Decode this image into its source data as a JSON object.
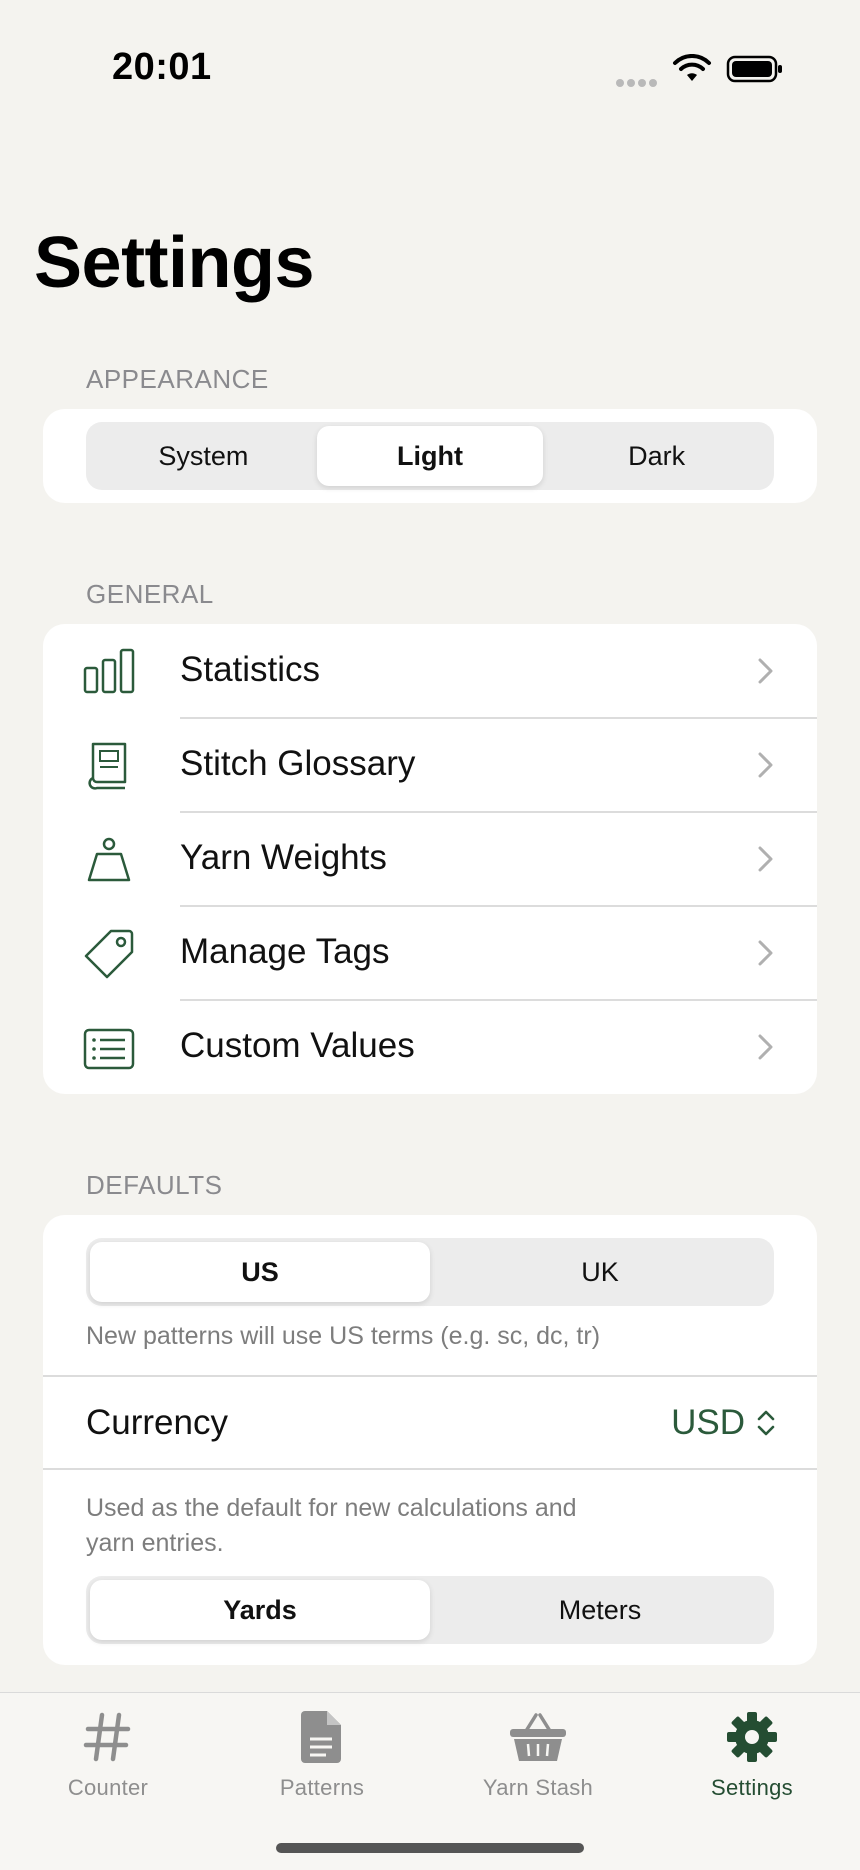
{
  "status_bar": {
    "time": "20:01"
  },
  "page": {
    "title": "Settings"
  },
  "appearance": {
    "header": "APPEARANCE",
    "options": [
      "System",
      "Light",
      "Dark"
    ],
    "selected": "Light"
  },
  "general": {
    "header": "GENERAL",
    "items": [
      {
        "label": "Statistics",
        "icon": "bar-chart-icon"
      },
      {
        "label": "Stitch Glossary",
        "icon": "book-icon"
      },
      {
        "label": "Yarn Weights",
        "icon": "weight-icon"
      },
      {
        "label": "Manage Tags",
        "icon": "tag-icon"
      },
      {
        "label": "Custom Values",
        "icon": "list-icon"
      }
    ]
  },
  "defaults": {
    "header": "DEFAULTS",
    "terms": {
      "options": [
        "US",
        "UK"
      ],
      "selected": "US"
    },
    "terms_hint": "New patterns will use US terms (e.g. sc, dc, tr)",
    "currency": {
      "label": "Currency",
      "value": "USD"
    },
    "units_hint_line1": "Used as the default for new calculations and",
    "units_hint_line2": "yarn entries.",
    "units": {
      "options": [
        "Yards",
        "Meters"
      ],
      "selected": "Yards"
    }
  },
  "tab_bar": {
    "tabs": [
      {
        "label": "Counter",
        "icon": "hash-icon"
      },
      {
        "label": "Patterns",
        "icon": "document-icon"
      },
      {
        "label": "Yarn Stash",
        "icon": "basket-icon"
      },
      {
        "label": "Settings",
        "icon": "gear-icon"
      }
    ],
    "active": "Settings"
  },
  "colors": {
    "accent": "#2b5a3b",
    "background": "#f4f3ef",
    "card": "#ffffff",
    "secondary_text": "#8a8a8e"
  }
}
